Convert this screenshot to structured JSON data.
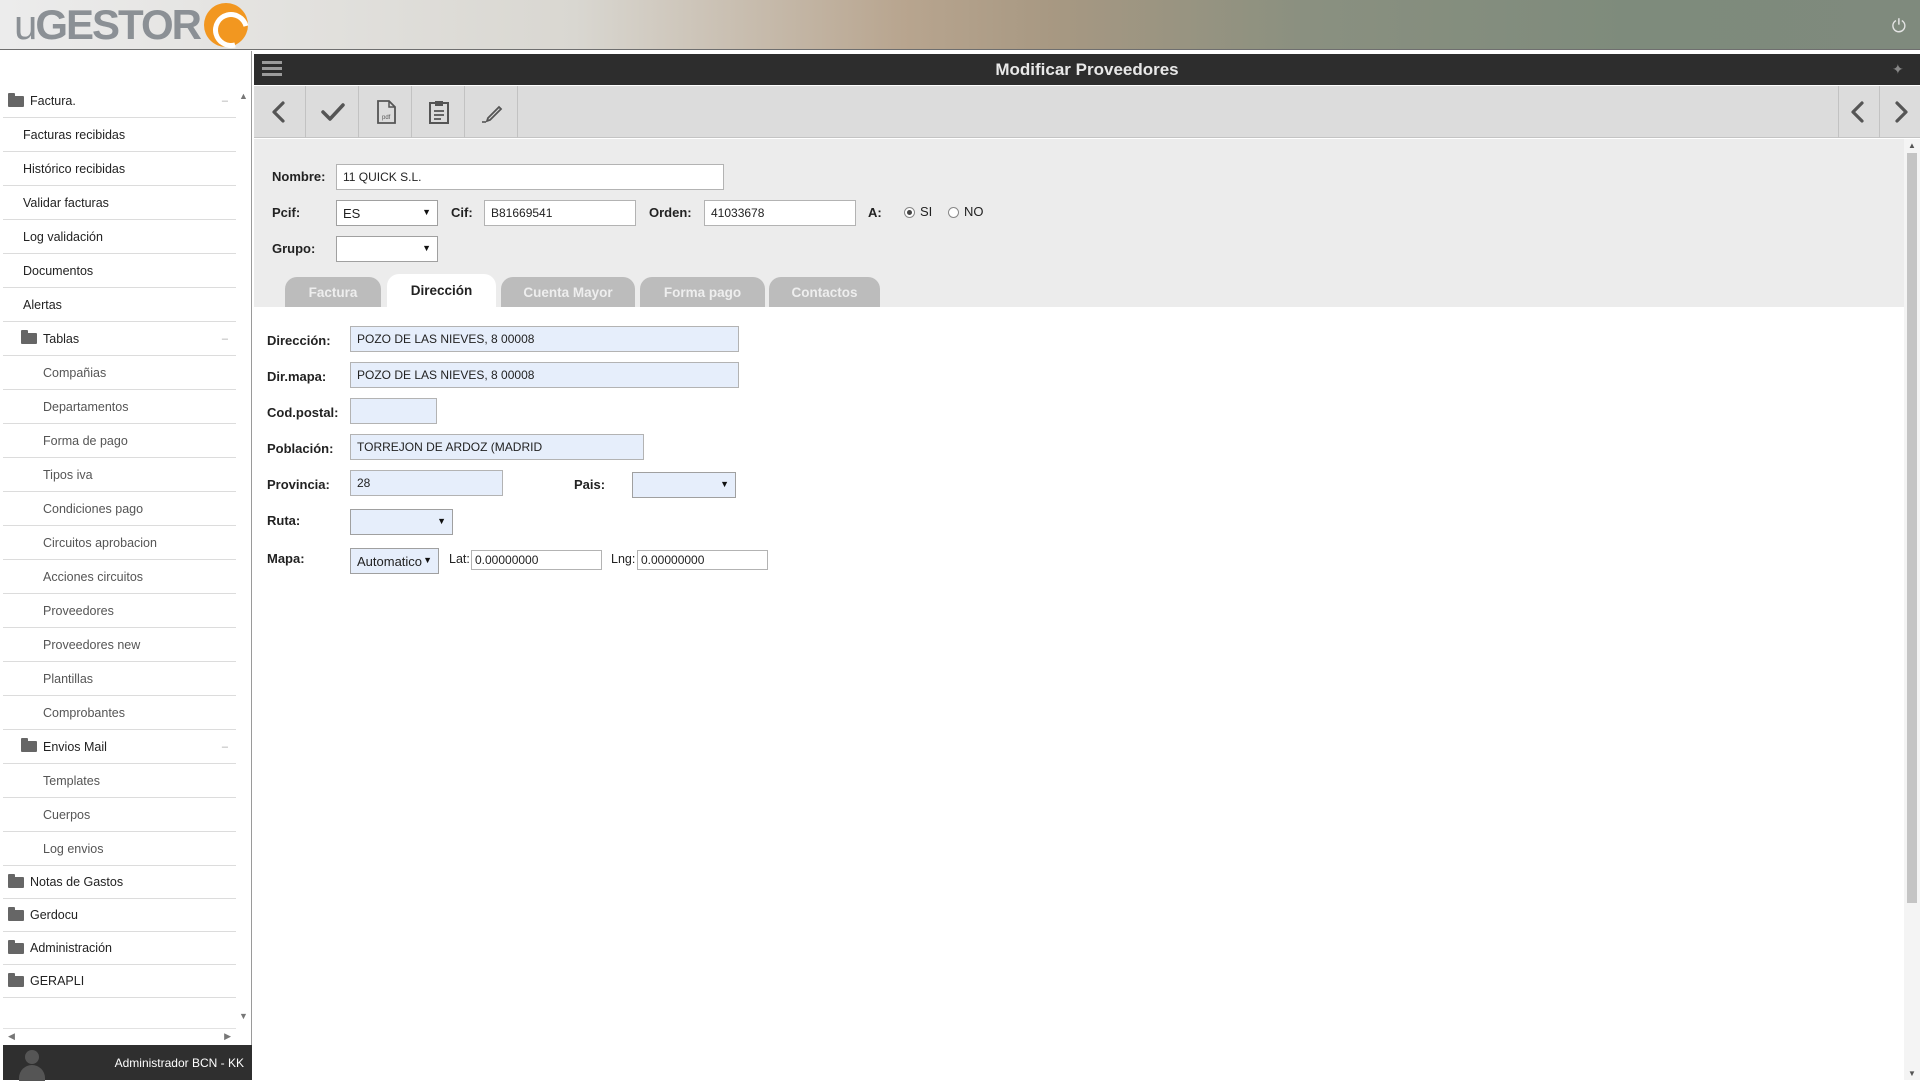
{
  "brand": {
    "logo_prefix": "u",
    "logo_main": "GESTOR"
  },
  "sidebar": {
    "items": [
      {
        "label": "Factura.",
        "kind": "folder"
      },
      {
        "label": "Facturas recibidas",
        "kind": "lvl1"
      },
      {
        "label": "Histórico recibidas",
        "kind": "lvl1"
      },
      {
        "label": "Validar facturas",
        "kind": "lvl1"
      },
      {
        "label": "Log validación",
        "kind": "lvl1"
      },
      {
        "label": "Documentos",
        "kind": "lvl1"
      },
      {
        "label": "Alertas",
        "kind": "lvl1"
      },
      {
        "label": "Tablas",
        "kind": "subfolder"
      },
      {
        "label": "Compañias",
        "kind": "lvl2"
      },
      {
        "label": "Departamentos",
        "kind": "lvl2"
      },
      {
        "label": "Forma de pago",
        "kind": "lvl2"
      },
      {
        "label": "Tipos iva",
        "kind": "lvl2"
      },
      {
        "label": "Condiciones pago",
        "kind": "lvl2"
      },
      {
        "label": "Circuitos aprobacion",
        "kind": "lvl2"
      },
      {
        "label": "Acciones circuitos",
        "kind": "lvl2"
      },
      {
        "label": "Proveedores",
        "kind": "lvl2"
      },
      {
        "label": "Proveedores new",
        "kind": "lvl2"
      },
      {
        "label": "Plantillas",
        "kind": "lvl2"
      },
      {
        "label": "Comprobantes",
        "kind": "lvl2"
      },
      {
        "label": "Envios Mail",
        "kind": "subfolder"
      },
      {
        "label": "Templates",
        "kind": "lvl2"
      },
      {
        "label": "Cuerpos",
        "kind": "lvl2"
      },
      {
        "label": "Log envios",
        "kind": "lvl2"
      },
      {
        "label": "Notas de Gastos",
        "kind": "folder"
      },
      {
        "label": "Gerdocu",
        "kind": "folder"
      },
      {
        "label": "Administración",
        "kind": "folder"
      },
      {
        "label": "GERAPLI",
        "kind": "folder"
      }
    ],
    "user": "Administrador BCN - KK"
  },
  "header": {
    "title": "Modificar Proveedores"
  },
  "form": {
    "nombre_label": "Nombre:",
    "nombre_value": "11 QUICK S.L.",
    "pcif_label": "Pcif:",
    "pcif_value": "ES",
    "cif_label": "Cif:",
    "cif_value": "B81669541",
    "orden_label": "Orden:",
    "orden_value": "41033678",
    "a_label": "A:",
    "si_label": "SI",
    "no_label": "NO",
    "grupo_label": "Grupo:",
    "grupo_value": ""
  },
  "tabs": [
    {
      "label": "Factura",
      "active": false
    },
    {
      "label": "Dirección",
      "active": true
    },
    {
      "label": "Cuenta Mayor",
      "active": false
    },
    {
      "label": "Forma pago",
      "active": false
    },
    {
      "label": "Contactos",
      "active": false
    }
  ],
  "direccion": {
    "direccion_label": "Dirección:",
    "direccion_value": "POZO DE LAS NIEVES, 8    00008",
    "dirmapa_label": "Dir.mapa:",
    "dirmapa_value": "POZO DE LAS NIEVES, 8    00008",
    "codpostal_label": "Cod.postal:",
    "codpostal_value": "",
    "poblacion_label": "Población:",
    "poblacion_value": "TORREJON DE ARDOZ (MADRID",
    "provincia_label": "Provincia:",
    "provincia_value": "28",
    "pais_label": "Pais:",
    "pais_value": "",
    "ruta_label": "Ruta:",
    "ruta_value": "",
    "mapa_label": "Mapa:",
    "mapa_value": "Automatico",
    "lat_label": "Lat:",
    "lat_value": "0.00000000",
    "lng_label": "Lng:",
    "lng_value": "0.00000000"
  },
  "colors": {
    "header_bg": "#2d2d2d",
    "toolbar_bg": "#dcdcdc",
    "input_blue": "#e6eefb",
    "logo_orange": "#f29720"
  }
}
